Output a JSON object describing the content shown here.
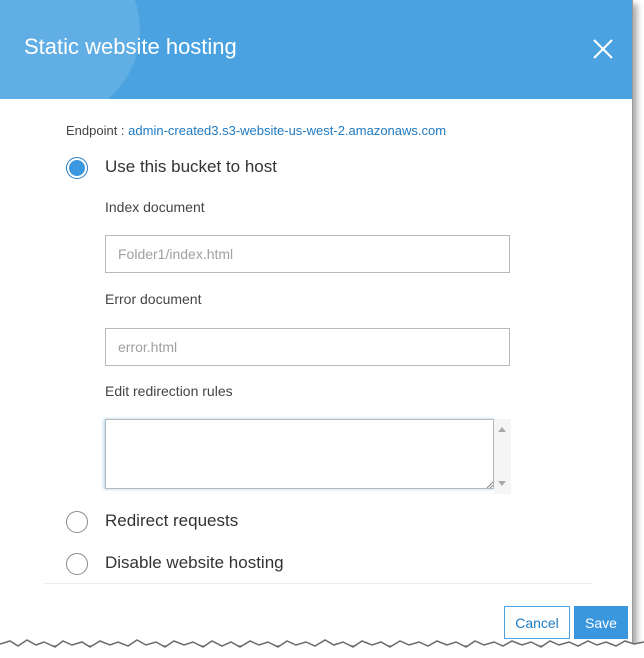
{
  "dialog": {
    "title": "Static website hosting"
  },
  "endpoint": {
    "label": "Endpoint :",
    "value": "admin-created3.s3-website-us-west-2.amazonaws.com"
  },
  "options": {
    "host": {
      "label": "Use this bucket to host",
      "checked": true,
      "index_label": "Index document",
      "index_value": "",
      "index_placeholder": "Folder1/index.html",
      "error_label": "Error document",
      "error_value": "",
      "error_placeholder": "error.html",
      "rules_label": "Edit redirection rules",
      "rules_value": ""
    },
    "redirect": {
      "label": "Redirect requests",
      "checked": false
    },
    "disable": {
      "label": "Disable website hosting",
      "checked": false
    }
  },
  "footer": {
    "cancel_label": "Cancel",
    "save_label": "Save"
  },
  "colors": {
    "header": "#4aa3e0",
    "primary": "#3a97dd",
    "link": "#1f7ac0"
  },
  "icons": {
    "close": "close-icon",
    "globe": "globe-icon"
  }
}
